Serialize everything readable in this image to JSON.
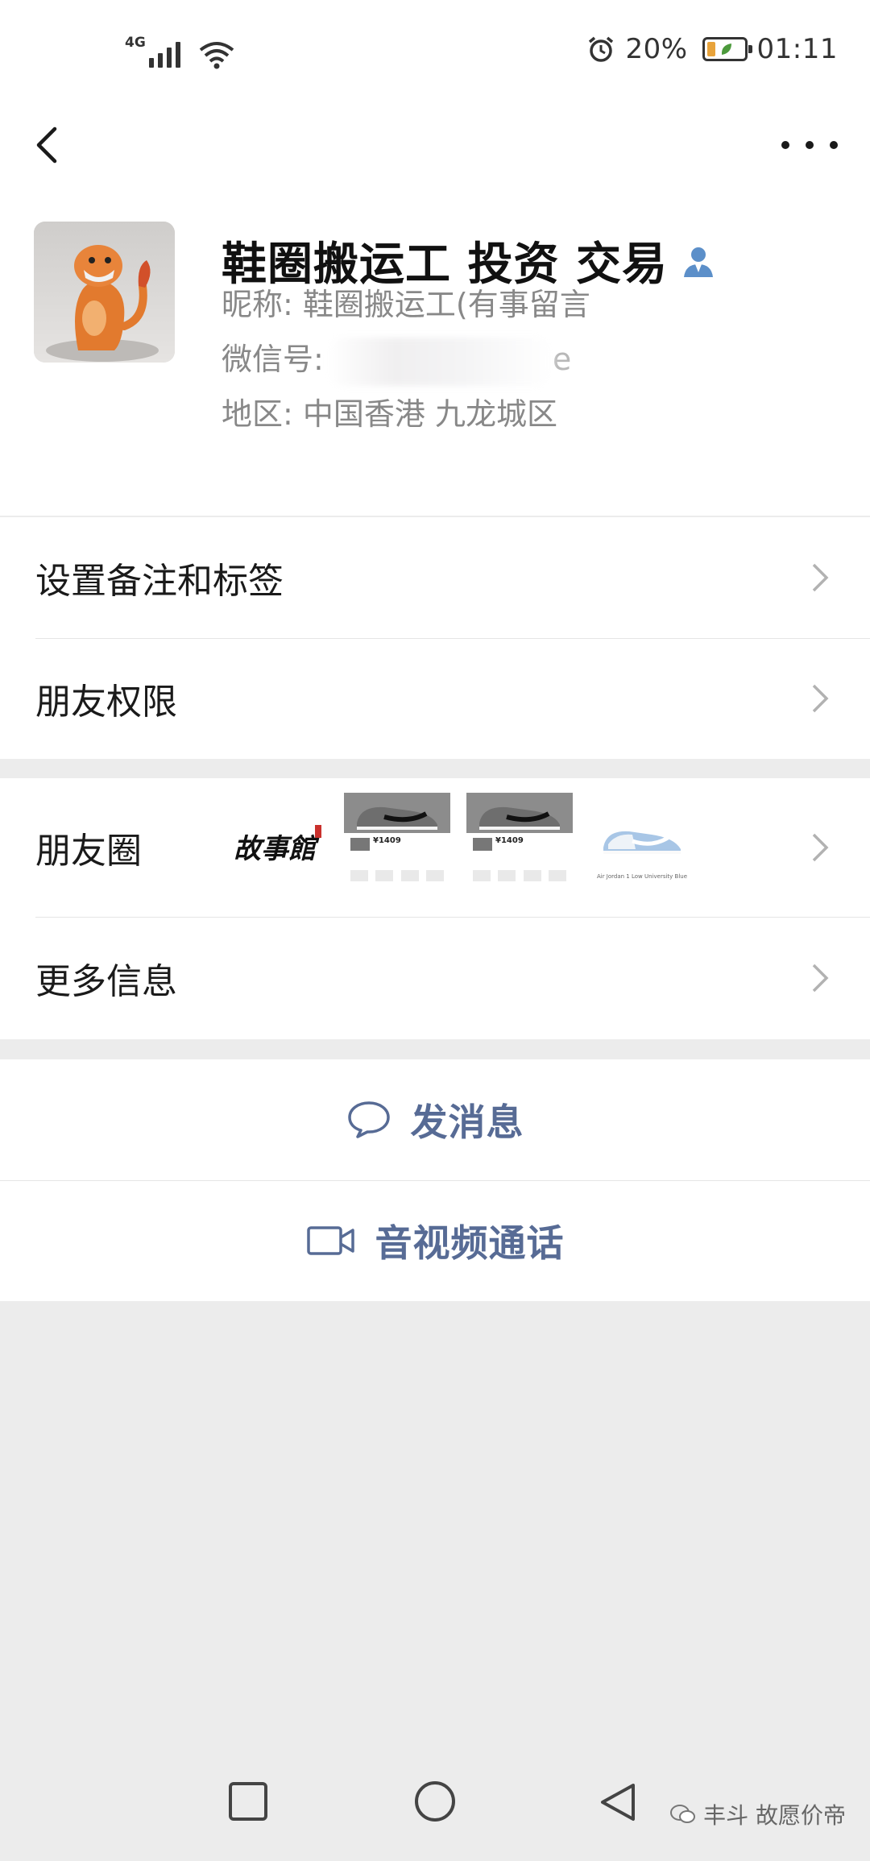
{
  "status_bar": {
    "network": "4G",
    "battery_percent": "20%",
    "time": "01:11",
    "battery_level": 0.2,
    "icons": [
      "signal-icon",
      "wifi-icon",
      "alarm-icon",
      "battery-icon"
    ]
  },
  "nav": {
    "back_icon": "chevron-left-icon",
    "more_icon": "more-dots-icon"
  },
  "profile": {
    "display_name": "鞋圈搬运工  投资 交易",
    "nickname_line": "昵称: 鞋圈搬运工(有事留言",
    "wechat_id_label": "微信号:",
    "wechat_id_tail": "e",
    "region_line": "地区: 中国香港  九龙城区"
  },
  "menu": {
    "remark_tags": "设置备注和标签",
    "friend_permissions": "朋友权限",
    "moments": "朋友圈",
    "more_info": "更多信息"
  },
  "moments_thumbs": {
    "calligraphy": "故事館",
    "price": "¥1409",
    "product_caption": "Air Jordan 1 Low University Blue"
  },
  "actions": {
    "send_message": "发消息",
    "video_call": "音视频通话"
  },
  "watermark": "丰斗 故愿价帝",
  "colors": {
    "link_blue": "#576b95",
    "page_bg": "#ececec",
    "card_bg": "#ffffff"
  }
}
